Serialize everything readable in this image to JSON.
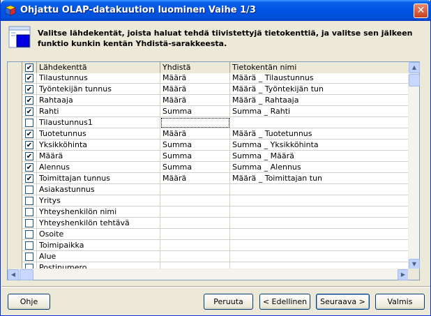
{
  "window": {
    "title": "Ohjattu OLAP-datakuution luominen Vaihe 1/3",
    "close_label": "✕"
  },
  "header": {
    "instructions": "Valitse lähdekentät, joista haluat tehdä tiivistettyjä tietokenttiä, ja valitse sen jälkeen funktio kunkin kentän Yhdistä-sarakkeesta."
  },
  "grid": {
    "columns": {
      "source": "Lähdekenttä",
      "combine": "Yhdistä",
      "name": "Tietokentän nimi"
    },
    "rows": [
      {
        "checked": true,
        "source": "Tilaustunnus",
        "combine": "Määrä",
        "name": "Määrä _ Tilaustunnus"
      },
      {
        "checked": true,
        "source": "Työntekijän tunnus",
        "combine": "Määrä",
        "name": "Määrä _ Työntekijän tun"
      },
      {
        "checked": true,
        "source": "Rahtaaja",
        "combine": "Määrä",
        "name": "Määrä _ Rahtaaja"
      },
      {
        "checked": true,
        "source": "Rahti",
        "combine": "Summa",
        "name": "Summa _ Rahti"
      },
      {
        "checked": false,
        "source": "Tilaustunnus1",
        "combine": "",
        "name": ""
      },
      {
        "checked": true,
        "source": "Tuotetunnus",
        "combine": "Määrä",
        "name": "Määrä _ Tuotetunnus"
      },
      {
        "checked": true,
        "source": "Yksikköhinta",
        "combine": "Summa",
        "name": "Summa _ Yksikköhinta"
      },
      {
        "checked": true,
        "source": "Määrä",
        "combine": "Summa",
        "name": "Summa _ Määrä"
      },
      {
        "checked": true,
        "source": "Alennus",
        "combine": "Summa",
        "name": "Summa _ Alennus"
      },
      {
        "checked": true,
        "source": "Toimittajan tunnus",
        "combine": "Määrä",
        "name": "Määrä _ Toimittajan tun"
      },
      {
        "checked": false,
        "source": "Asiakastunnus",
        "combine": "",
        "name": ""
      },
      {
        "checked": false,
        "source": "Yritys",
        "combine": "",
        "name": ""
      },
      {
        "checked": false,
        "source": "Yhteyshenkilön nimi",
        "combine": "",
        "name": ""
      },
      {
        "checked": false,
        "source": "Yhteyshenkilön tehtävä",
        "combine": "",
        "name": ""
      },
      {
        "checked": false,
        "source": "Osoite",
        "combine": "",
        "name": ""
      },
      {
        "checked": false,
        "source": "Toimipaikka",
        "combine": "",
        "name": ""
      },
      {
        "checked": false,
        "source": "Alue",
        "combine": "",
        "name": ""
      },
      {
        "checked": false,
        "source": "Postinumero",
        "combine": "",
        "name": ""
      }
    ]
  },
  "buttons": {
    "help": "Ohje",
    "cancel": "Peruuta",
    "back": "< Edellinen",
    "next": "Seuraava >",
    "finish": "Valmis"
  }
}
